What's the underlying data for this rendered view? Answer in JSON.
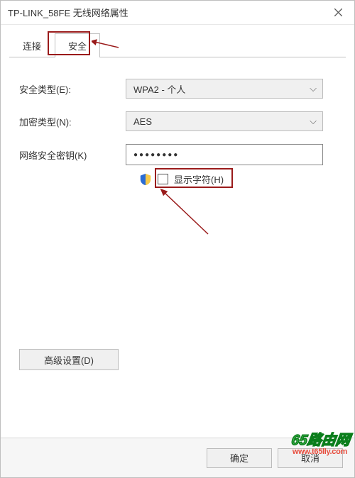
{
  "window": {
    "title": "TP-LINK_58FE 无线网络属性"
  },
  "tabs": {
    "connect": "连接",
    "security": "安全"
  },
  "labels": {
    "security_type": "安全类型(E):",
    "encryption_type": "加密类型(N):",
    "network_key": "网络安全密钥(K)",
    "show_chars": "显示字符(H)",
    "advanced": "高级设置(D)"
  },
  "values": {
    "security_type": "WPA2 - 个人",
    "encryption_type": "AES",
    "network_key": "●●●●●●●●"
  },
  "buttons": {
    "ok": "确定",
    "cancel": "取消"
  },
  "watermark": {
    "text": "65路由网",
    "url": "www.t65lly.com"
  }
}
